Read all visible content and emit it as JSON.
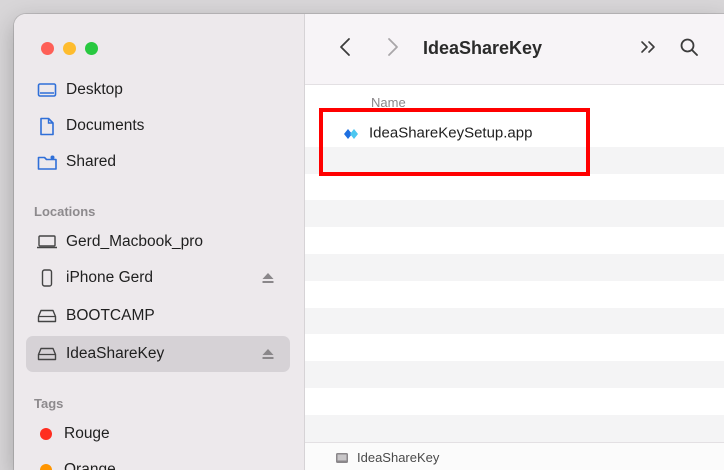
{
  "window": {
    "title": "IdeaShareKey"
  },
  "sidebar": {
    "favorites": [
      {
        "label": "Desktop",
        "icon": "desktop-icon"
      },
      {
        "label": "Documents",
        "icon": "document-icon"
      },
      {
        "label": "Shared",
        "icon": "shared-folder-icon"
      }
    ],
    "locations_title": "Locations",
    "locations": [
      {
        "label": "Gerd_Macbook_pro",
        "icon": "laptop-icon",
        "eject": false,
        "selected": false
      },
      {
        "label": "iPhone Gerd",
        "icon": "iphone-icon",
        "eject": true,
        "selected": false
      },
      {
        "label": "BOOTCAMP",
        "icon": "drive-icon",
        "eject": false,
        "selected": false
      },
      {
        "label": "IdeaShareKey",
        "icon": "drive-icon",
        "eject": true,
        "selected": true
      }
    ],
    "tags_title": "Tags",
    "tags": [
      {
        "label": "Rouge",
        "color": "#ff2d20"
      },
      {
        "label": "Orange",
        "color": "#ff9500"
      }
    ]
  },
  "toolbar": {
    "back_icon": "chevron-left-icon",
    "forward_icon": "chevron-right-icon",
    "more_icon": "double-chevron-right-icon",
    "search_icon": "search-icon"
  },
  "list": {
    "column_name": "Name",
    "files": [
      {
        "name": "IdeaShareKeySetup.app",
        "icon": "app-diamond-icon"
      }
    ]
  },
  "pathbar": {
    "label": "IdeaShareKey",
    "icon": "drive-icon"
  },
  "annotation": {
    "color": "#ff0000"
  }
}
